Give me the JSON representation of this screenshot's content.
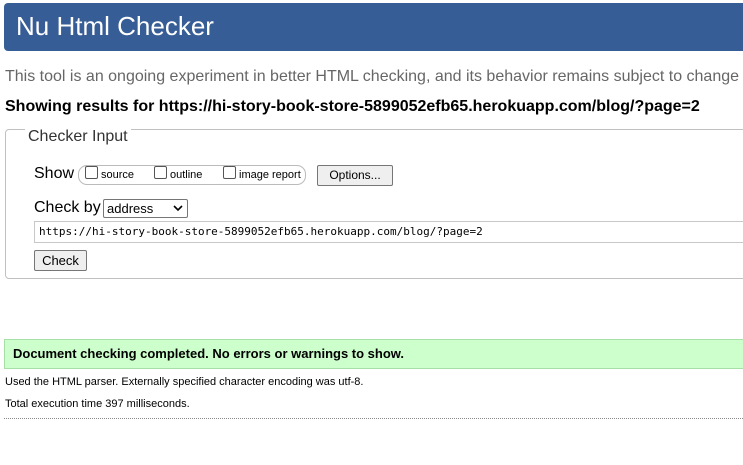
{
  "header": {
    "title": "Nu Html Checker"
  },
  "intro_text": "This tool is an ongoing experiment in better HTML checking, and its behavior remains subject to change",
  "showing": {
    "prefix": "Showing results for ",
    "url": "https://hi-story-book-store-5899052efb65.herokuapp.com/blog/?page=2"
  },
  "checker_input": {
    "legend": "Checker Input",
    "show_label": "Show",
    "checkboxes": [
      {
        "label": "source",
        "checked": false
      },
      {
        "label": "outline",
        "checked": false
      },
      {
        "label": "image report",
        "checked": false
      }
    ],
    "options_label": "Options...",
    "check_by_label": "Check by",
    "check_by_selected": "address",
    "address_value": "https://hi-story-book-store-5899052efb65.herokuapp.com/blog/?page=2",
    "check_label": "Check"
  },
  "result": {
    "message": "Document checking completed. No errors or warnings to show.",
    "parser_info": "Used the HTML parser. Externally specified character encoding was utf-8.",
    "execution_time": "Total execution time 397 milliseconds."
  },
  "colors": {
    "header_bg": "#365d95",
    "success_bg": "#ccffcc"
  }
}
